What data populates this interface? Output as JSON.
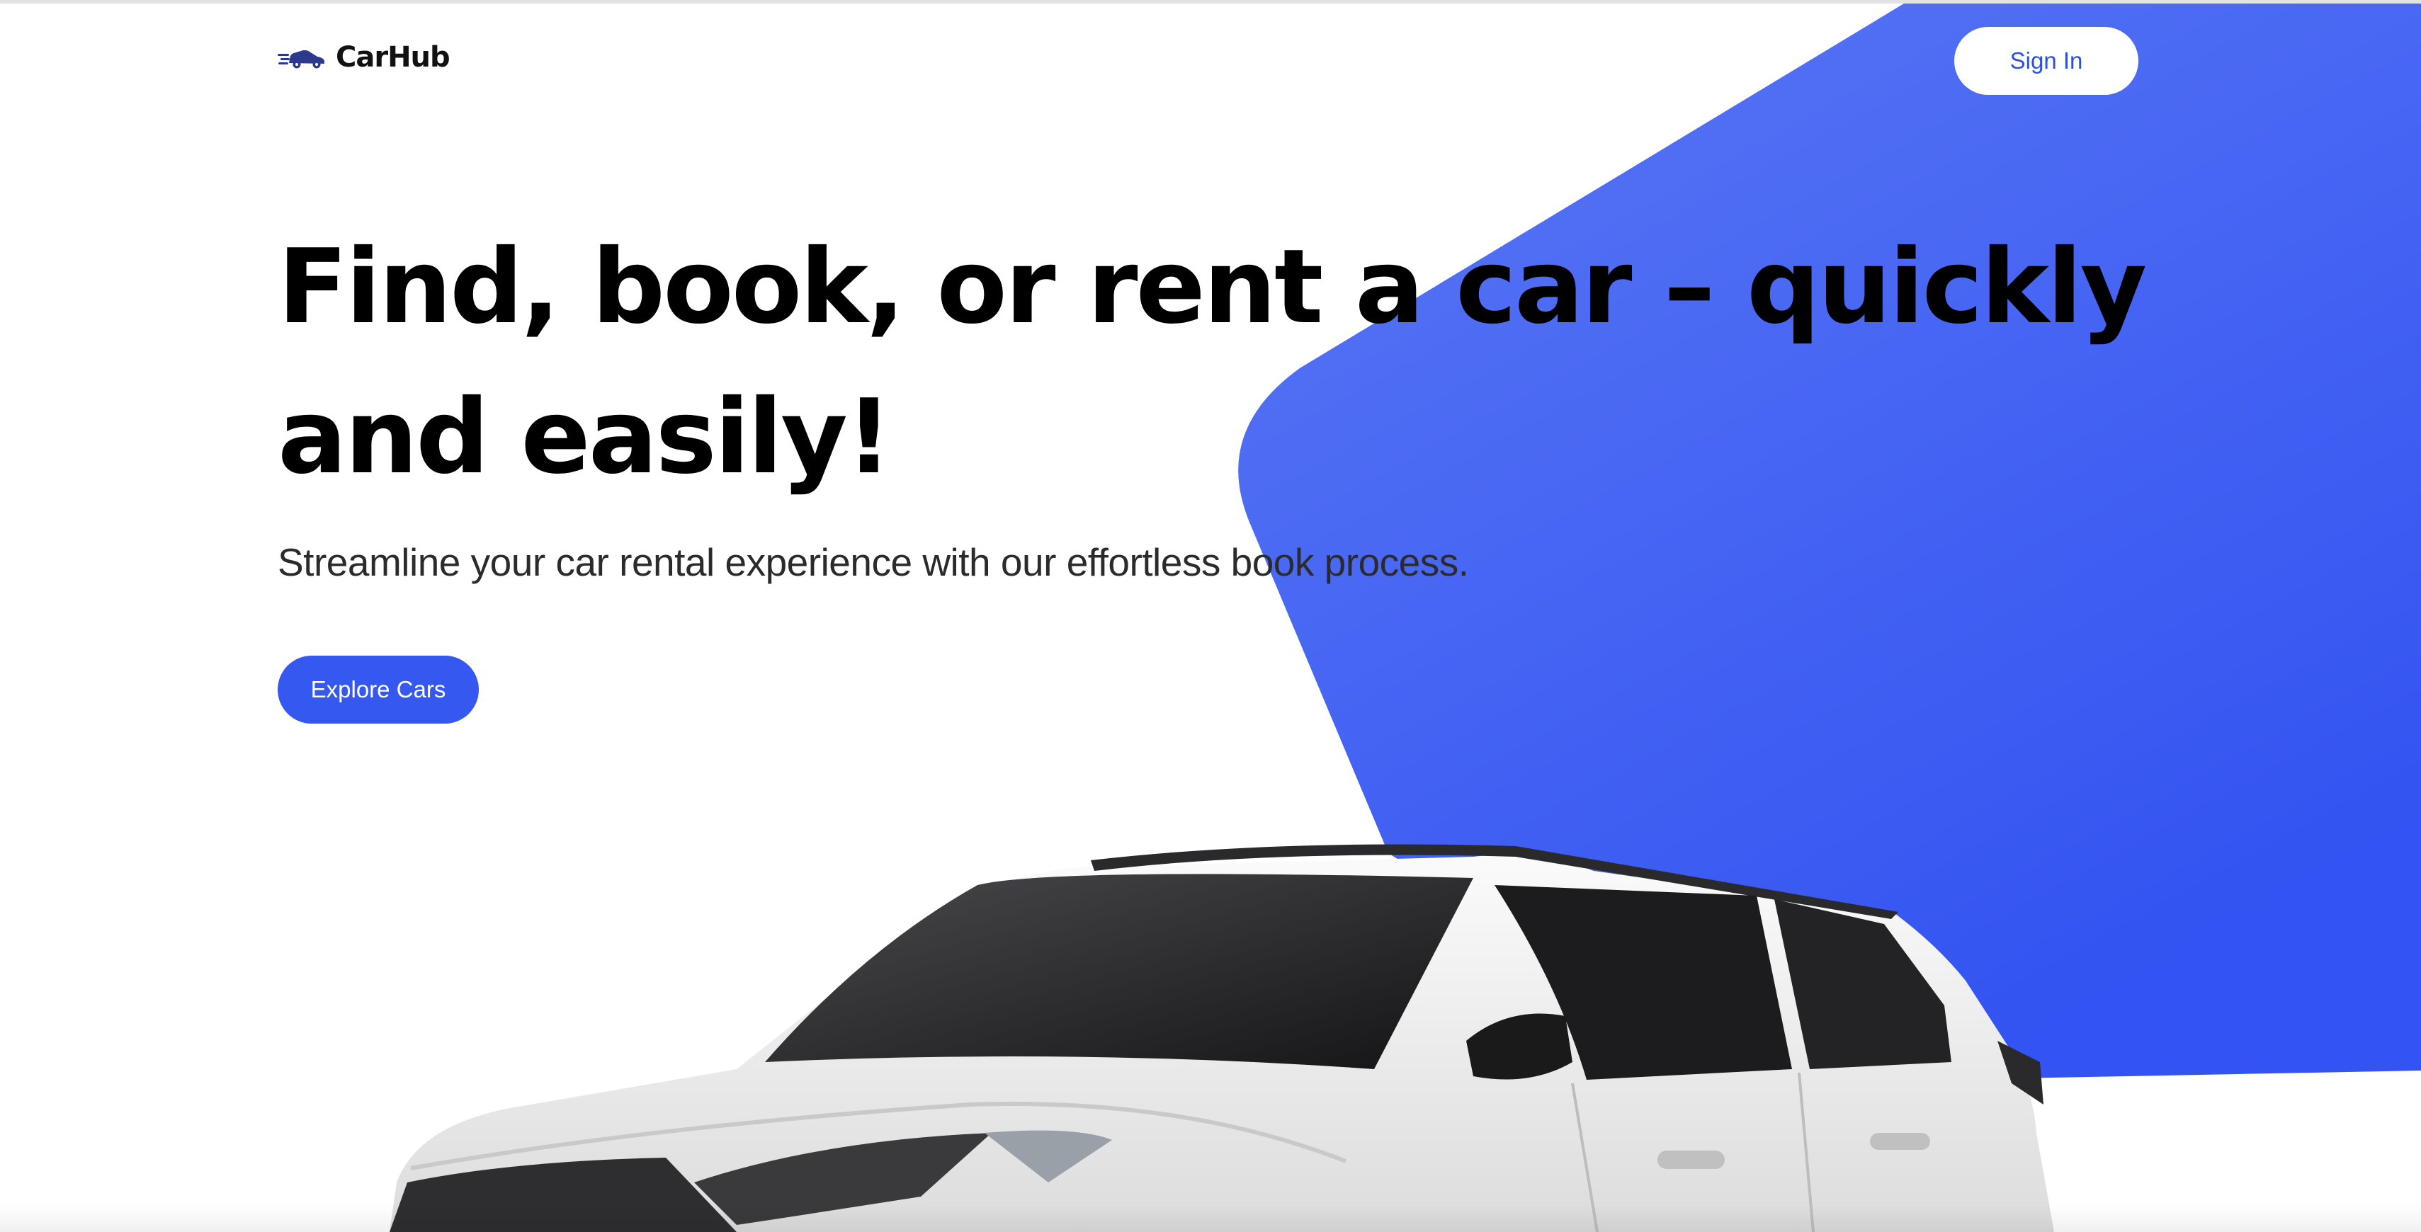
{
  "brand": {
    "name": "CarHub",
    "icon": "car-speed-icon",
    "icon_color": "#2b3a8f"
  },
  "nav": {
    "signin_label": "Sign In"
  },
  "hero": {
    "title": "Find, book, or rent a car – quickly and easily!",
    "subtitle": "Streamline your car rental experience with our effortless book process.",
    "cta_label": "Explore Cars",
    "image": "white-suv-photo"
  },
  "colors": {
    "accent": "#3559f0",
    "accent_light": "#5a78f4",
    "signin_text": "#2b4fe3",
    "text": "#000000",
    "car_body": "#f1f1f1",
    "car_glass": "#1c1c1e"
  }
}
